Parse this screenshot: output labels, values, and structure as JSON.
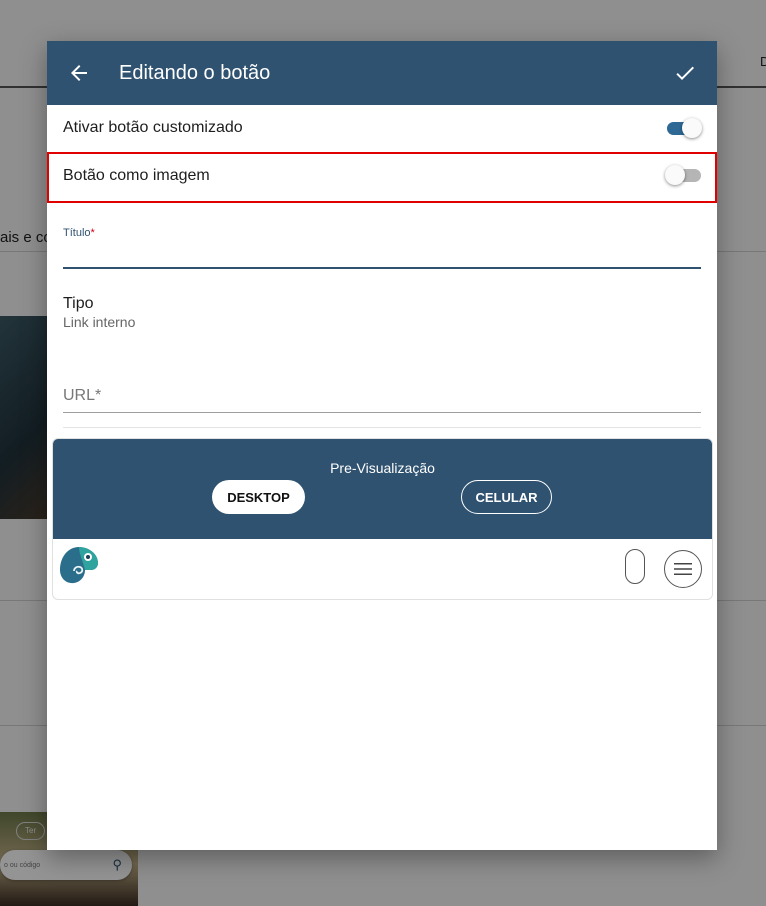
{
  "background": {
    "right_edge_text": "D",
    "partial_text": "ais e co",
    "chip_text": "Ter",
    "search_placeholder": "o ou código"
  },
  "dialog": {
    "title": "Editando o botão",
    "back_icon": "arrow-left-icon",
    "confirm_icon": "check-icon",
    "colors": {
      "header": "#2f5270",
      "highlight": "#e00000",
      "toggle_on": "#2e6895"
    }
  },
  "toggles": {
    "custom_button": {
      "label": "Ativar botão customizado",
      "checked": true
    },
    "image_button": {
      "label": "Botão como imagem",
      "checked": false
    }
  },
  "fields": {
    "titulo": {
      "label": "Título",
      "required_mark": "*",
      "value": ""
    },
    "tipo": {
      "label": "Tipo",
      "value": "Link interno"
    },
    "url": {
      "placeholder": "URL*",
      "value": ""
    }
  },
  "preview": {
    "label": "Pre-Visualização",
    "desktop_label": "DESKTOP",
    "celular_label": "CELULAR",
    "selected": "DESKTOP",
    "logo_icon": "chameleon-logo",
    "menu_icon": "hamburger-menu-icon"
  }
}
